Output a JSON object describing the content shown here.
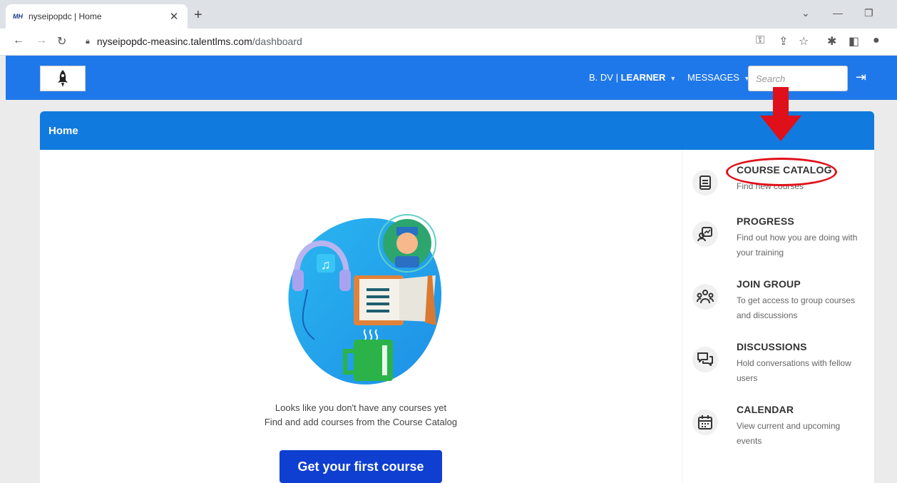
{
  "browser": {
    "tab_title": "nyseipopdc | Home",
    "tab_favicon": "MH",
    "url_host": "nyseipopdc-measinc.talentlms.com",
    "url_path": "/dashboard"
  },
  "header": {
    "user": "B. DV",
    "role": "LEARNER",
    "messages": "MESSAGES",
    "search_placeholder": "Search"
  },
  "card": {
    "title": "Home"
  },
  "empty_state": {
    "line1": "Looks like you don't have any courses yet",
    "line2": "Find and add courses from the Course Catalog",
    "button": "Get your first course"
  },
  "sidebar": {
    "items": [
      {
        "title": "COURSE CATALOG",
        "desc": "Find new courses",
        "icon": "book-icon"
      },
      {
        "title": "PROGRESS",
        "desc": "Find out how you are doing with your training",
        "icon": "progress-icon"
      },
      {
        "title": "JOIN GROUP",
        "desc": "To get access to group courses and discussions",
        "icon": "group-icon"
      },
      {
        "title": "DISCUSSIONS",
        "desc": "Hold conversations with fellow users",
        "icon": "discussion-icon"
      },
      {
        "title": "CALENDAR",
        "desc": "View current and upcoming events",
        "icon": "calendar-icon"
      }
    ]
  },
  "colors": {
    "header_blue": "#1f78ea",
    "card_header_blue": "#107ade",
    "cta_blue": "#0f3fd1",
    "annotation_red": "#e0101a"
  }
}
